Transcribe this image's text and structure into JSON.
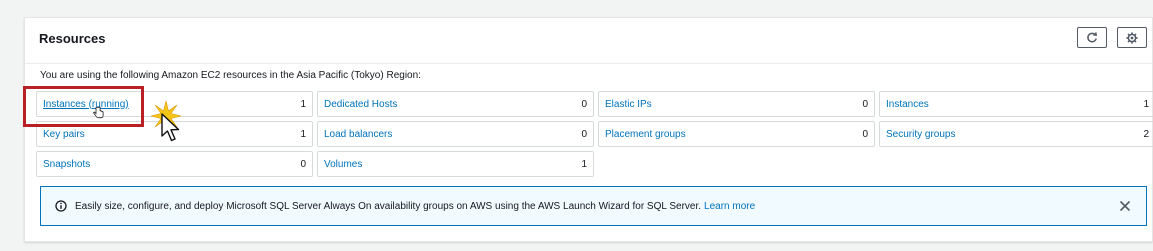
{
  "resources": {
    "title": "Resources",
    "intro": "You are using the following Amazon EC2 resources in the Asia Pacific (Tokyo) Region:",
    "refresh_icon": "refresh-icon",
    "settings_icon": "gear-icon",
    "items": [
      {
        "label": "Instances (running)",
        "count": "1"
      },
      {
        "label": "Dedicated Hosts",
        "count": "0"
      },
      {
        "label": "Elastic IPs",
        "count": "0"
      },
      {
        "label": "Instances",
        "count": "1"
      },
      {
        "label": "Key pairs",
        "count": "1"
      },
      {
        "label": "Load balancers",
        "count": "0"
      },
      {
        "label": "Placement groups",
        "count": "0"
      },
      {
        "label": "Security groups",
        "count": "2"
      },
      {
        "label": "Snapshots",
        "count": "0"
      },
      {
        "label": "Volumes",
        "count": "1"
      }
    ]
  },
  "alert": {
    "icon": "info-icon",
    "text": "Easily size, configure, and deploy Microsoft SQL Server Always On availability groups on AWS using the AWS Launch Wizard for SQL Server.",
    "link": "Learn more",
    "close_icon": "close-icon"
  },
  "colors": {
    "link": "#0073bb",
    "highlight": "#b82025",
    "alert_bg": "#f1faff",
    "text": "#16191f"
  }
}
